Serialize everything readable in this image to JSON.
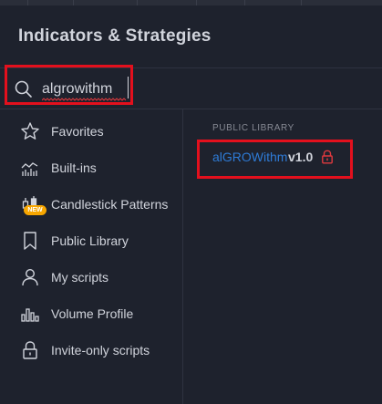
{
  "dialog": {
    "title": "Indicators & Strategies"
  },
  "search": {
    "value": "algrowithm",
    "icon": "search-icon"
  },
  "sidebar": {
    "items": [
      {
        "label": "Favorites",
        "icon": "star-icon"
      },
      {
        "label": "Built-ins",
        "icon": "built-ins-chart-icon"
      },
      {
        "label": "Candlestick Patterns",
        "icon": "candlestick-icon",
        "badge": "NEW"
      },
      {
        "label": "Public Library",
        "icon": "bookmark-icon"
      },
      {
        "label": "My scripts",
        "icon": "user-icon"
      },
      {
        "label": "Volume Profile",
        "icon": "volume-profile-icon"
      },
      {
        "label": "Invite-only scripts",
        "icon": "lock-icon"
      }
    ]
  },
  "results": {
    "section_header": "PUBLIC LIBRARY",
    "items": [
      {
        "name": "alGROWithm",
        "version": "v1.0",
        "icon": "lock-icon"
      }
    ]
  },
  "colors": {
    "background": "#1e222d",
    "text": "#d1d4dc",
    "muted": "#868993",
    "link": "#2e7bd6",
    "highlight": "#e3101d",
    "badge": "#f7a600"
  }
}
